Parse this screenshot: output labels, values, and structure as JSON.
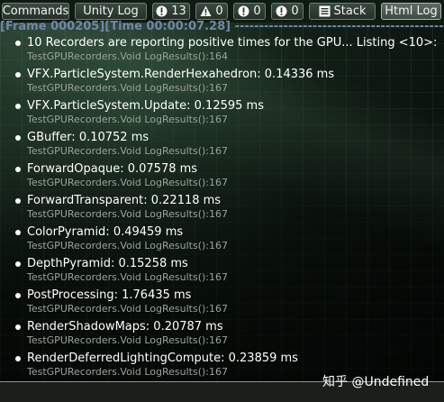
{
  "toolbar": {
    "commands": "Commands",
    "unity_log": "Unity Log",
    "info_count": "13",
    "warn_count": "0",
    "error_count": "0",
    "exception_count": "0",
    "stack": "Stack",
    "html_log": "Html Log"
  },
  "header": "[Frame 000205][Time 00:00:07.28] --------------------------------------------------------",
  "entries": [
    {
      "message": "10 Recorders are reporting positive times for the GPU... Listing <10>:",
      "source": "TestGPURecorders.Void LogResults():164"
    },
    {
      "message": "VFX.ParticleSystem.RenderHexahedron: 0.14336 ms",
      "source": "TestGPURecorders.Void LogResults():167"
    },
    {
      "message": "VFX.ParticleSystem.Update: 0.12595 ms",
      "source": "TestGPURecorders.Void LogResults():167"
    },
    {
      "message": "GBuffer: 0.10752 ms",
      "source": "TestGPURecorders.Void LogResults():167"
    },
    {
      "message": "ForwardOpaque: 0.07578 ms",
      "source": "TestGPURecorders.Void LogResults():167"
    },
    {
      "message": "ForwardTransparent: 0.22118 ms",
      "source": "TestGPURecorders.Void LogResults():167"
    },
    {
      "message": "ColorPyramid: 0.49459 ms",
      "source": "TestGPURecorders.Void LogResults():167"
    },
    {
      "message": "DepthPyramid: 0.15258 ms",
      "source": "TestGPURecorders.Void LogResults():167"
    },
    {
      "message": "PostProcessing: 1.76435 ms",
      "source": "TestGPURecorders.Void LogResults():167"
    },
    {
      "message": "RenderShadowMaps: 0.20787 ms",
      "source": "TestGPURecorders.Void LogResults():167"
    },
    {
      "message": "RenderDeferredLightingCompute: 0.23859 ms",
      "source": "TestGPURecorders.Void LogResults():167"
    }
  ],
  "watermark": "知乎 @Undefined"
}
